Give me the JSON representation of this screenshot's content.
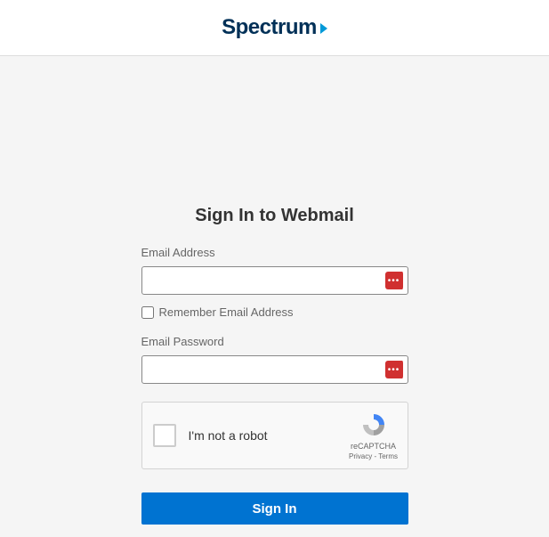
{
  "header": {
    "brand_name": "Spectrum"
  },
  "form": {
    "title": "Sign In to Webmail",
    "email_label": "Email Address",
    "email_value": "",
    "remember_label": "Remember Email Address",
    "remember_checked": false,
    "password_label": "Email Password",
    "password_value": "",
    "submit_label": "Sign In"
  },
  "recaptcha": {
    "label": "I'm not a robot",
    "brand": "reCAPTCHA",
    "links": "Privacy - Terms"
  }
}
